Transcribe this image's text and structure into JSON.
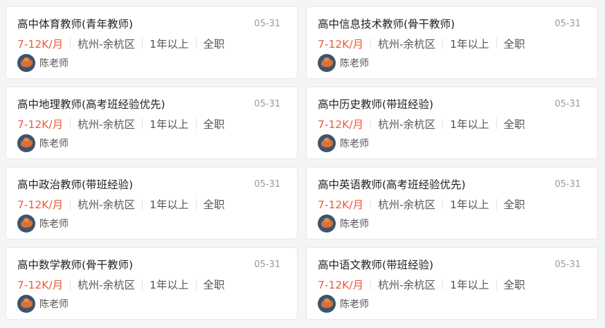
{
  "jobs": [
    {
      "title": "高中体育教师(青年教师)",
      "date": "05-31",
      "salary": "7-12K/月",
      "location": "杭州-余杭区",
      "experience": "1年以上",
      "type": "全职",
      "recruiter": "陈老师"
    },
    {
      "title": "高中信息技术教师(骨干教师)",
      "date": "05-31",
      "salary": "7-12K/月",
      "location": "杭州-余杭区",
      "experience": "1年以上",
      "type": "全职",
      "recruiter": "陈老师"
    },
    {
      "title": "高中地理教师(高考班经验优先)",
      "date": "05-31",
      "salary": "7-12K/月",
      "location": "杭州-余杭区",
      "experience": "1年以上",
      "type": "全职",
      "recruiter": "陈老师"
    },
    {
      "title": "高中历史教师(带班经验)",
      "date": "05-31",
      "salary": "7-12K/月",
      "location": "杭州-余杭区",
      "experience": "1年以上",
      "type": "全职",
      "recruiter": "陈老师"
    },
    {
      "title": "高中政治教师(带班经验)",
      "date": "05-31",
      "salary": "7-12K/月",
      "location": "杭州-余杭区",
      "experience": "1年以上",
      "type": "全职",
      "recruiter": "陈老师"
    },
    {
      "title": "高中英语教师(高考班经验优先)",
      "date": "05-31",
      "salary": "7-12K/月",
      "location": "杭州-余杭区",
      "experience": "1年以上",
      "type": "全职",
      "recruiter": "陈老师"
    },
    {
      "title": "高中数学教师(骨干教师)",
      "date": "05-31",
      "salary": "7-12K/月",
      "location": "杭州-余杭区",
      "experience": "1年以上",
      "type": "全职",
      "recruiter": "陈老师"
    },
    {
      "title": "高中语文教师(带班经验)",
      "date": "05-31",
      "salary": "7-12K/月",
      "location": "杭州-余杭区",
      "experience": "1年以上",
      "type": "全职",
      "recruiter": "陈老师"
    }
  ],
  "colors": {
    "salary": "#ee5a3a",
    "title": "#222222",
    "meta": "#555555",
    "date": "#999999",
    "card_border": "#e6e8ec",
    "avatar_bg": "#3e546c",
    "avatar_fg": "#d8703a"
  },
  "icons": {
    "avatar": "recruiter-avatar-icon"
  }
}
